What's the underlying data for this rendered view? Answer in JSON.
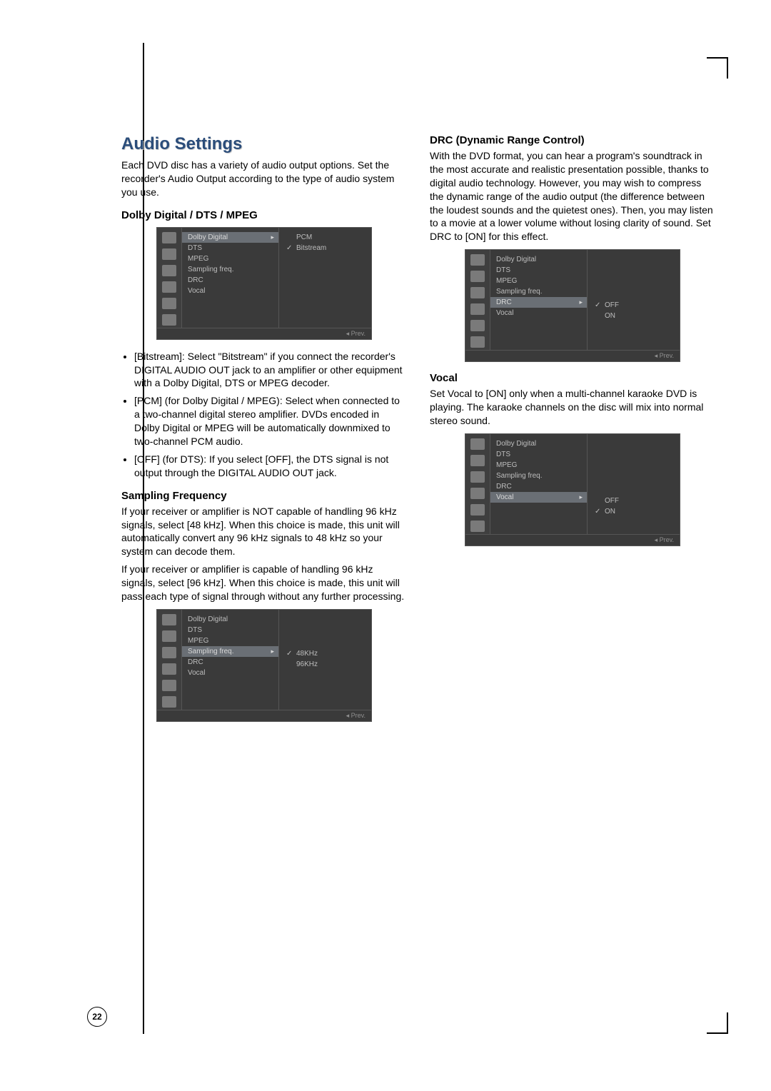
{
  "page_number": "22",
  "title": "Audio Settings",
  "intro": "Each DVD disc has a variety of audio output options. Set the recorder's Audio Output according to the type of audio system you use.",
  "dolby": {
    "heading": "Dolby Digital / DTS / MPEG",
    "bullets": [
      "[Bitstream]: Select \"Bitstream\" if you connect the recorder's DIGITAL AUDIO OUT jack to an amplifier or other equipment with a Dolby Digital, DTS or MPEG decoder.",
      "[PCM] (for Dolby Digital / MPEG): Select when connected to a two-channel digital stereo amplifier. DVDs encoded in Dolby Digital or MPEG will be automatically downmixed to two-channel PCM audio.",
      "[OFF] (for DTS): If you select [OFF], the DTS signal is not output through the DIGITAL AUDIO OUT jack."
    ]
  },
  "sampling": {
    "heading": "Sampling Frequency",
    "p1": "If your receiver or amplifier is NOT capable of handling 96 kHz signals, select [48 kHz]. When this choice is made, this unit will automatically convert any 96 kHz signals to 48 kHz so your system can decode them.",
    "p2": "If your receiver or amplifier is capable of handling 96 kHz signals, select [96 kHz]. When this choice is made, this unit will pass each type of signal through without any further processing."
  },
  "drc": {
    "heading": "DRC (Dynamic Range Control)",
    "p": "With the DVD format, you can hear a program's soundtrack in the most accurate and realistic presentation possible, thanks to digital audio technology. However, you may wish to compress the dynamic range of the audio output (the difference between the loudest sounds and the quietest ones). Then, you may listen to a movie at a lower volume without losing clarity of sound. Set DRC to [ON] for this effect."
  },
  "vocal": {
    "heading": "Vocal",
    "p": "Set Vocal to [ON] only when a multi-channel karaoke DVD is playing. The karaoke channels on the disc will mix into normal stereo sound."
  },
  "menu_items": {
    "dolby_digital": "Dolby Digital",
    "dts": "DTS",
    "mpeg": "MPEG",
    "sampling_freq": "Sampling freq.",
    "drc": "DRC",
    "vocal": "Vocal"
  },
  "menu_options": {
    "pcm": "PCM",
    "bitstream": "Bitstream",
    "k48": "48KHz",
    "k96": "96KHz",
    "off": "OFF",
    "on": "ON"
  },
  "menu_footer": "◂ Prev."
}
